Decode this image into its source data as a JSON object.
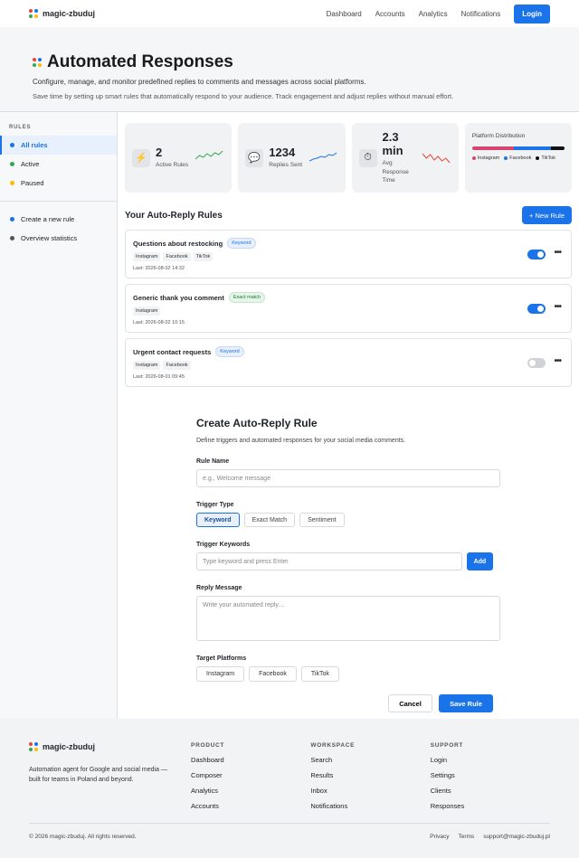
{
  "brand": {
    "name": "magic-zbuduj"
  },
  "nav": {
    "links": [
      "Dashboard",
      "Accounts",
      "Analytics",
      "Notifications"
    ],
    "login": "Login"
  },
  "hero": {
    "title": "Automated Responses",
    "subtitle": "Configure, manage, and monitor predefined replies to comments and messages across social platforms.",
    "description": "Save time by setting up smart rules that automatically respond to your audience. Track engagement and adjust replies without manual effort."
  },
  "sidebar": {
    "title": "RULES",
    "items": [
      {
        "label": "All rules",
        "color": "#1a73e8"
      },
      {
        "label": "Active",
        "color": "#34a853"
      },
      {
        "label": "Paused",
        "color": "#fbbc05"
      }
    ],
    "extra": [
      {
        "label": "Create a new rule",
        "color": "#1a73e8"
      },
      {
        "label": "Overview statistics",
        "color": "#555555"
      }
    ]
  },
  "stats": [
    {
      "icon": "lightning-icon",
      "glyph": "⚡",
      "value": "2",
      "label": "Active Rules",
      "spark_color": "#34a853"
    },
    {
      "icon": "speech-bubble-icon",
      "glyph": "💬",
      "value": "1234",
      "label": "Replies Sent",
      "spark_color": "#1a73e8"
    },
    {
      "icon": "stopwatch-icon",
      "glyph": "⏱",
      "value": "2.3 min",
      "label": "Avg Response Time",
      "spark_color": "#e8453c"
    }
  ],
  "distribution": {
    "title": "Platform Distribution",
    "segments": [
      {
        "name": "Instagram",
        "color": "#d6456f",
        "share": 0.45
      },
      {
        "name": "Facebook",
        "color": "#1a73e8",
        "share": 0.4
      },
      {
        "name": "TikTok",
        "color": "#111111",
        "share": 0.15
      }
    ]
  },
  "rules_section": {
    "title": "Your Auto-Reply Rules",
    "new_button": "+ New Rule",
    "rules": [
      {
        "title": "Questions about restocking",
        "type": "Keyword",
        "type_style": "blue",
        "platforms": [
          "Instagram",
          "Facebook",
          "TikTok"
        ],
        "last": "Last: 2026-08-02 14:32",
        "enabled": true
      },
      {
        "title": "Generic thank you comment",
        "type": "Exact match",
        "type_style": "green",
        "platforms": [
          "Instagram"
        ],
        "last": "Last: 2026-08-02 10:15",
        "enabled": true
      },
      {
        "title": "Urgent contact requests",
        "type": "Keyword",
        "type_style": "blue",
        "platforms": [
          "Instagram",
          "Facebook"
        ],
        "last": "Last: 2026-08-01 09:45",
        "enabled": false
      }
    ]
  },
  "form": {
    "title": "Create Auto-Reply Rule",
    "description": "Define triggers and automated responses for your social media comments.",
    "rule_name_label": "Rule Name",
    "rule_name_placeholder": "e.g., Welcome message",
    "trigger_type_label": "Trigger Type",
    "trigger_types": [
      "Keyword",
      "Exact Match",
      "Sentiment"
    ],
    "trigger_selected": "Keyword",
    "keywords_label": "Trigger Keywords",
    "keywords_placeholder": "Type keyword and press Enter",
    "add_button": "Add",
    "reply_label": "Reply Message",
    "reply_placeholder": "Write your automated reply…",
    "platforms_label": "Target Platforms",
    "platforms": [
      "Instagram",
      "Facebook",
      "TikTok"
    ],
    "cancel": "Cancel",
    "save": "Save Rule"
  },
  "footer": {
    "tagline": "Automation agent for Google and social media — built for teams in Poland and beyond.",
    "columns": [
      {
        "title": "PRODUCT",
        "links": [
          "Dashboard",
          "Composer",
          "Analytics",
          "Accounts"
        ]
      },
      {
        "title": "WORKSPACE",
        "links": [
          "Search",
          "Results",
          "Inbox",
          "Notifications"
        ]
      },
      {
        "title": "SUPPORT",
        "links": [
          "Login",
          "Settings",
          "Clients",
          "Responses"
        ]
      }
    ],
    "copyright": "© 2026 magic-zbuduj. All rights reserved.",
    "bottom_links": [
      "Privacy",
      "Terms",
      "support@magic-zbuduj.pl"
    ]
  }
}
